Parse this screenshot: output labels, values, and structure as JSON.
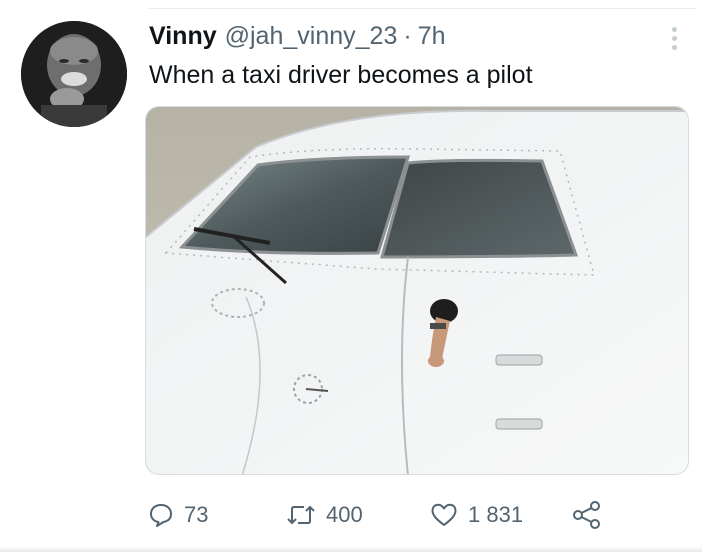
{
  "author": {
    "display_name": "Vinny",
    "handle": "@jah_vinny_23",
    "separator": "·",
    "time": "7h"
  },
  "tweet": {
    "text": "When a taxi driver becomes a pilot"
  },
  "actions": {
    "replies": "73",
    "retweets": "400",
    "likes": "1 831"
  },
  "colors": {
    "text_primary": "#0f1419",
    "text_secondary": "#536471"
  },
  "icons": {
    "more": "more-dots-icon",
    "reply": "reply-bubble-icon",
    "retweet": "retweet-arrows-icon",
    "like": "heart-icon",
    "share": "share-nodes-icon"
  }
}
